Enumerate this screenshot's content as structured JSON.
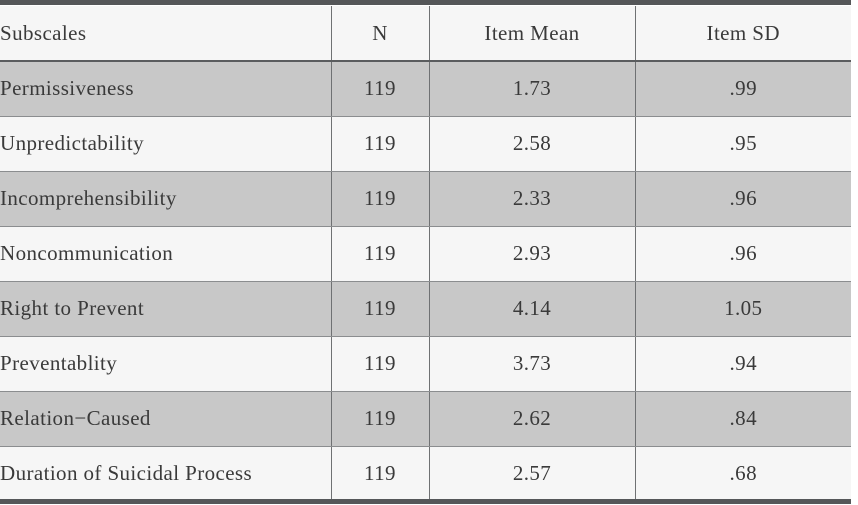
{
  "table": {
    "columns": [
      {
        "key": "subscale",
        "label": "Subscales",
        "align": "left"
      },
      {
        "key": "n",
        "label": "N",
        "align": "center"
      },
      {
        "key": "mean",
        "label": "Item Mean",
        "align": "center"
      },
      {
        "key": "sd",
        "label": "Item SD",
        "align": "center"
      }
    ],
    "rows": [
      {
        "subscale": "Permissiveness",
        "n": "119",
        "mean": "1.73",
        "sd": ".99"
      },
      {
        "subscale": "Unpredictability",
        "n": "119",
        "mean": "2.58",
        "sd": ".95"
      },
      {
        "subscale": "Incomprehensibility",
        "n": "119",
        "mean": "2.33",
        "sd": ".96"
      },
      {
        "subscale": "Noncommunication",
        "n": "119",
        "mean": "2.93",
        "sd": ".96"
      },
      {
        "subscale": "Right to Prevent",
        "n": "119",
        "mean": "4.14",
        "sd": "1.05"
      },
      {
        "subscale": "Preventablity",
        "n": "119",
        "mean": "3.73",
        "sd": ".94"
      },
      {
        "subscale": "Relation−Caused",
        "n": "119",
        "mean": "2.62",
        "sd": ".84"
      },
      {
        "subscale": "Duration of Suicidal Process",
        "n": "119",
        "mean": "2.57",
        "sd": ".68"
      }
    ]
  },
  "style": {
    "rule_color": "#555759",
    "shaded_row_color": "#c8c8c8",
    "plain_row_color": "#f6f6f6",
    "divider_color": "#6f7173",
    "text_color": "#3a3a3a"
  }
}
